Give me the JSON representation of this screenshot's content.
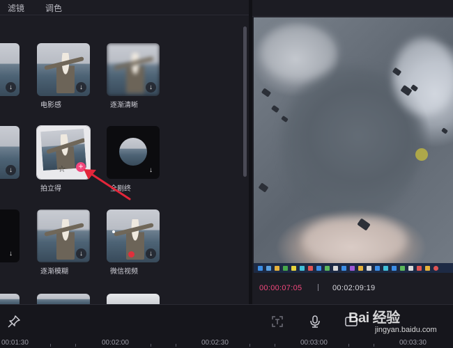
{
  "tabs": {
    "filter": "滤镜",
    "adjust": "调色"
  },
  "effects": [
    {
      "label": "",
      "download": "↓"
    },
    {
      "label": "电影感",
      "download": "↓"
    },
    {
      "label": "逐渐清晰",
      "download": "↓"
    },
    {
      "label": "",
      "download": "↓"
    },
    {
      "label": "拍立得",
      "download": "↓"
    },
    {
      "label": "全剧终",
      "download": "↓"
    },
    {
      "label": "",
      "download": "↓"
    },
    {
      "label": "逐渐模糊",
      "download": "↓"
    },
    {
      "label": "微信视频",
      "download": "↓"
    }
  ],
  "add_badge": "+",
  "preview": {
    "current_time": "00:00:07:05",
    "total_time": "00:02:09:19"
  },
  "ruler": {
    "ticks": [
      "00:01:30",
      "00:02:00",
      "00:02:30",
      "00:03:00",
      "00:03:30"
    ]
  },
  "watermark": {
    "logo": "Bai 经验",
    "url": "jingyan.baidu.com"
  },
  "colors": {
    "accent": "#f2477c",
    "background": "#1c1c23"
  }
}
